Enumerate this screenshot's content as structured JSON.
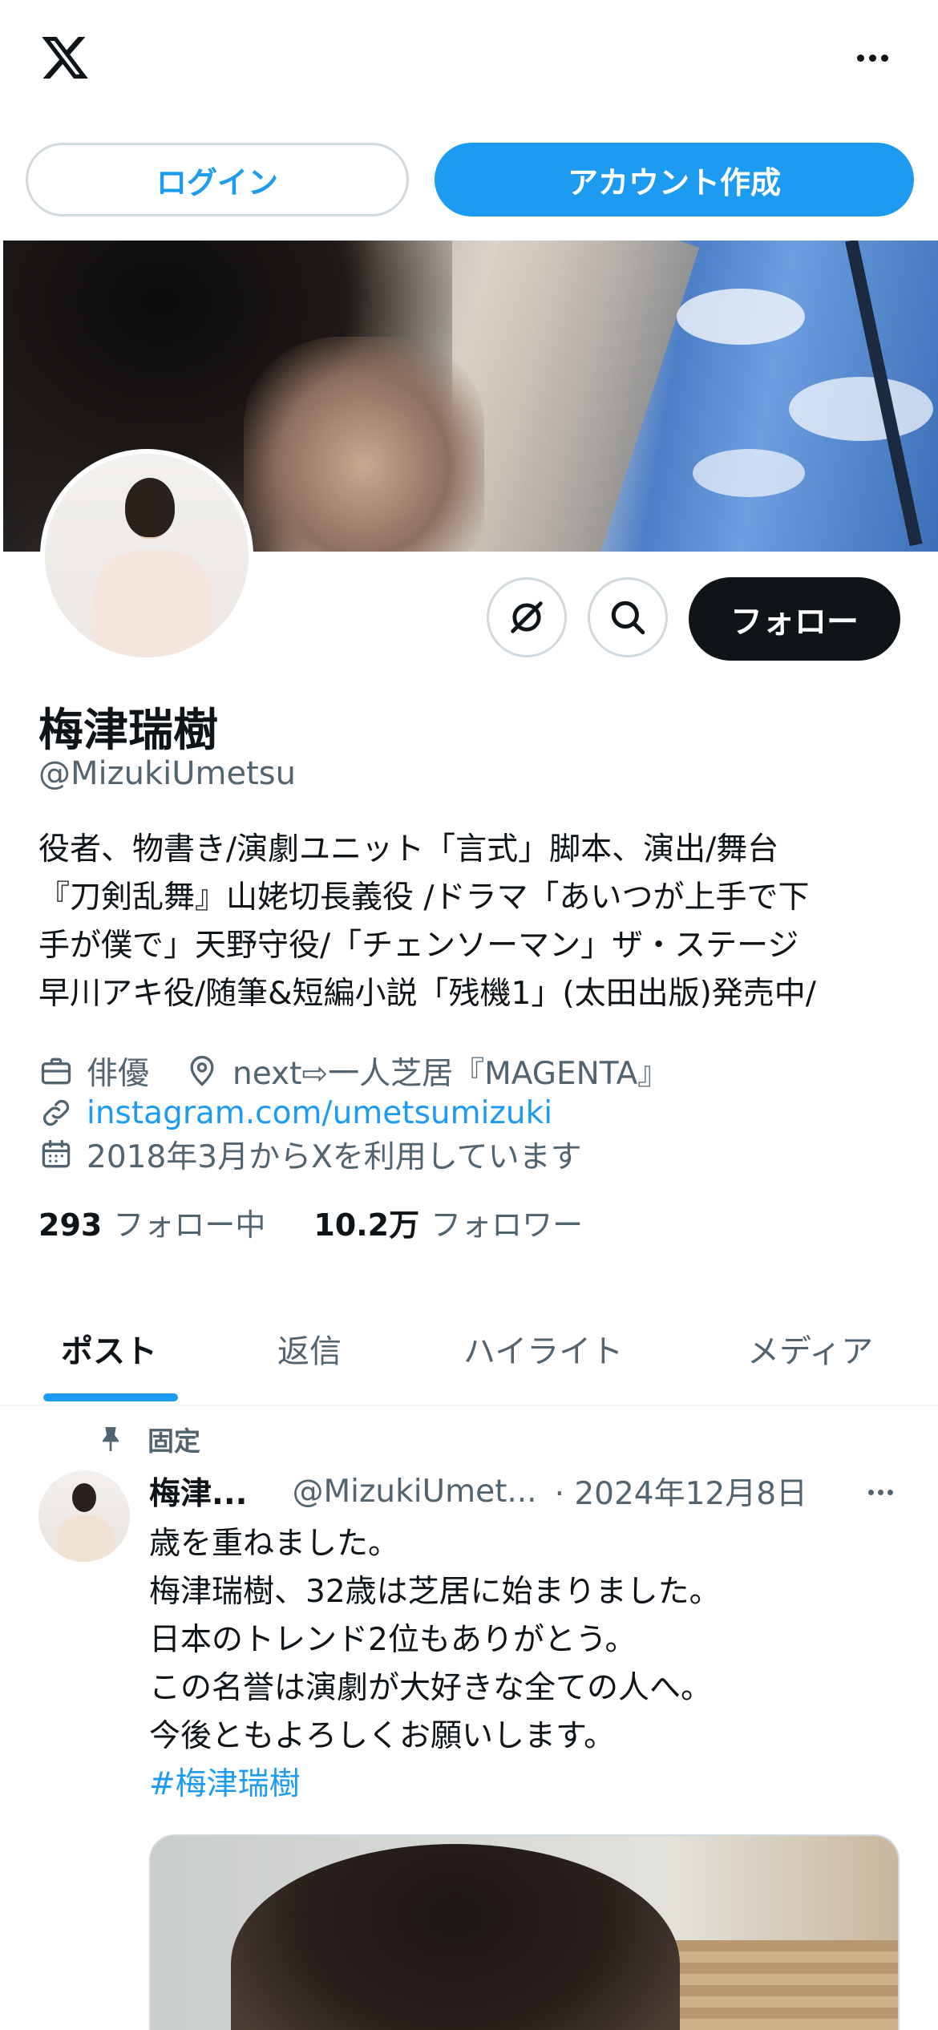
{
  "topbar": {
    "logo": "x-logo",
    "more": "more-icon"
  },
  "auth": {
    "login_label": "ログイン",
    "signup_label": "アカウント作成"
  },
  "profile": {
    "display_name": "梅津瑞樹",
    "handle": "@MizukiUmetsu",
    "follow_label": "フォロー",
    "bio_lines": [
      "役者、物書き/演劇ユニット「言式」脚本、演出/舞台",
      "『刀剣乱舞』山姥切長義役 /ドラマ「あいつが上手で下",
      "手が僕で」天野守役/「チェンソーマン」ザ・ステージ",
      "早川アキ役/随筆&短編小説「残機1」(太田出版)発売中/"
    ],
    "category": "俳優",
    "location": "next⇨一人芝居『MAGENTA』",
    "website": "instagram.com/umetsumizuki",
    "joined": "2018年3月からXを利用しています",
    "following_count": "293",
    "following_label": "フォロー中",
    "followers_count": "10.2万",
    "followers_label": "フォロワー"
  },
  "tabs": [
    {
      "label": "ポスト",
      "active": true
    },
    {
      "label": "返信",
      "active": false
    },
    {
      "label": "ハイライト",
      "active": false
    },
    {
      "label": "メディア",
      "active": false
    }
  ],
  "post": {
    "pinned_label": "固定",
    "author_name": "梅津...",
    "author_handle": "@MizukiUmet...",
    "date": "· 2024年12月8日",
    "lines": [
      "歳を重ねました。",
      "梅津瑞樹、32歳は芝居に始まりました。",
      "日本のトレンド2位もありがとう。",
      "この名誉は演劇が大好きな全ての人へ。",
      "今後ともよろしくお願いします。"
    ],
    "hashtag": "#梅津瑞樹"
  },
  "colors": {
    "accent": "#1d9bf0",
    "text": "#0f1419",
    "secondary": "#536471",
    "border": "#cfd9de"
  }
}
